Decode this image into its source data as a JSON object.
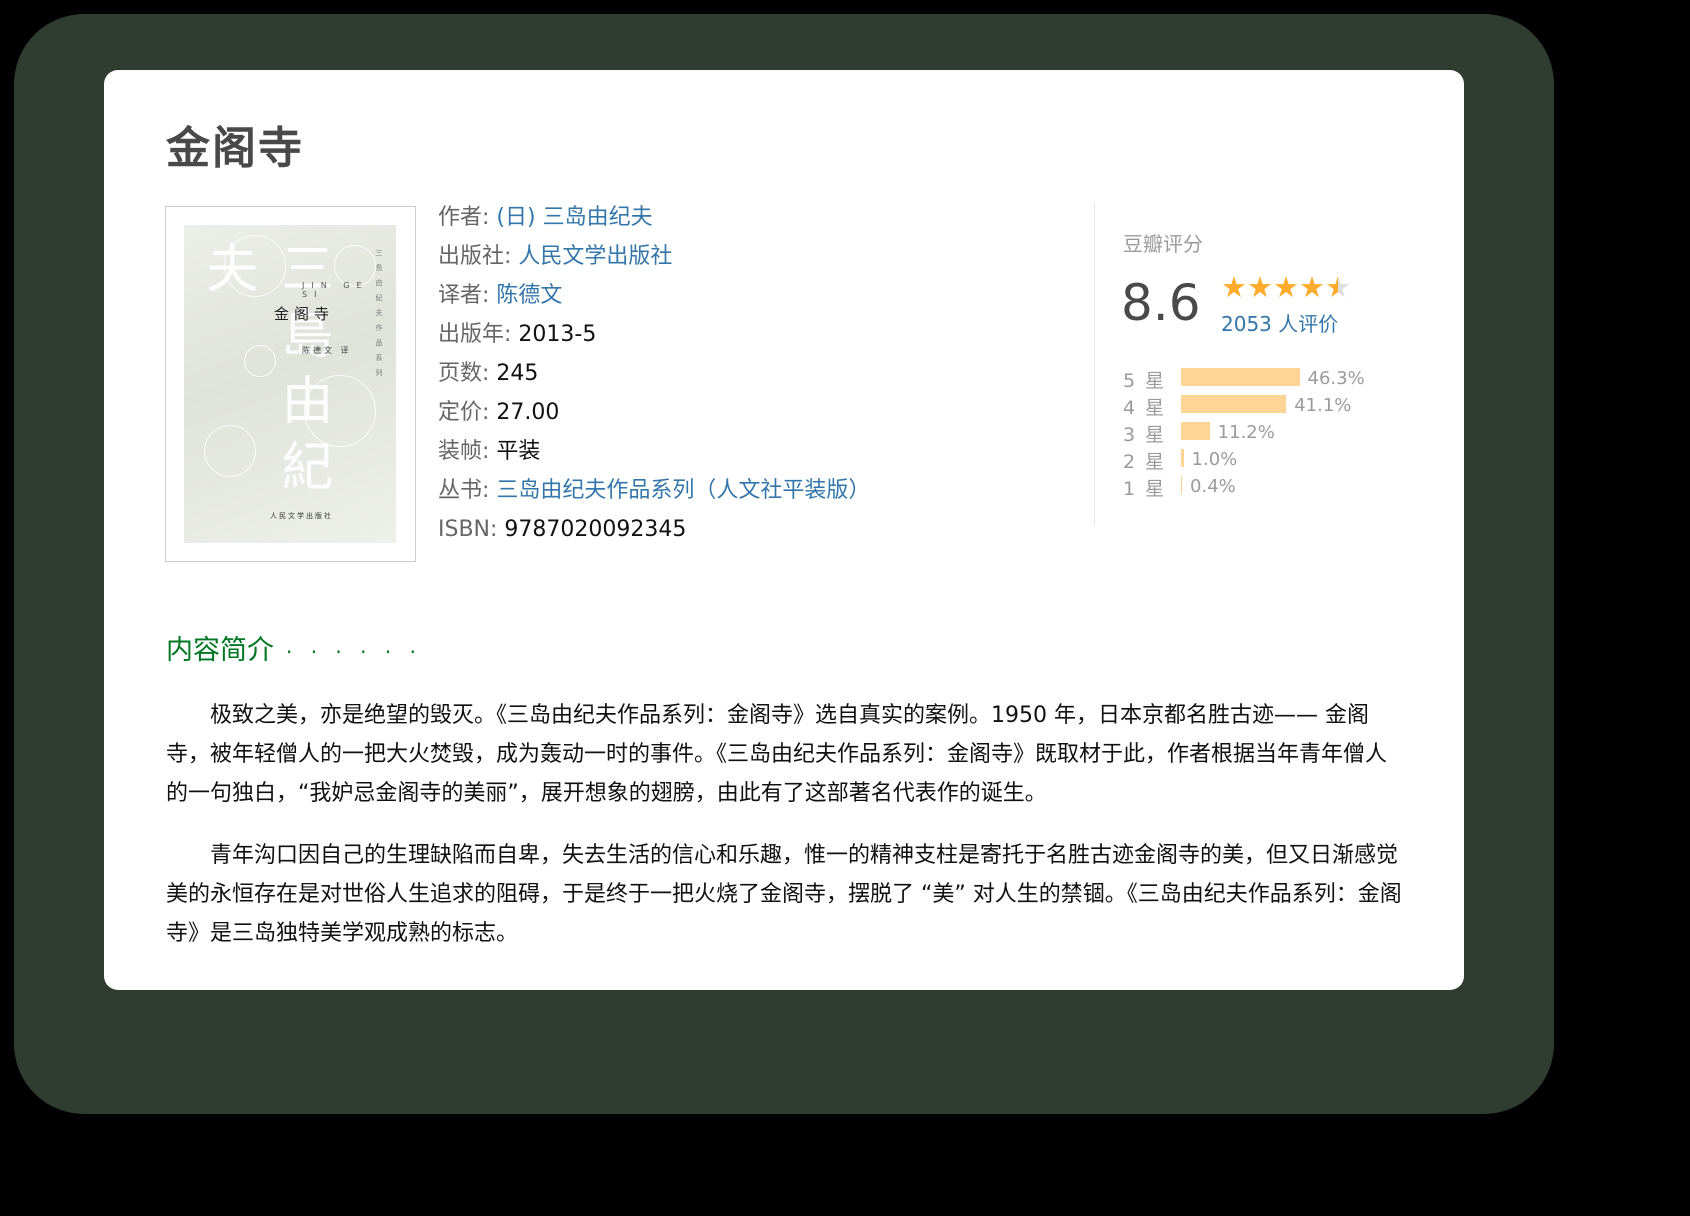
{
  "book": {
    "title": "金阁寺",
    "cover": {
      "romanized": "JIN GE SI",
      "title": "金阁寺",
      "translator_line": "陈德文 译",
      "publisher": "人民文学出版社",
      "brush_author": "三島由紀夫",
      "series_vertical": "三島由紀夫作品系列"
    },
    "info": {
      "author_label": "作者:",
      "author_value": "(日) 三岛由纪夫",
      "publisher_label": "出版社:",
      "publisher_value": "人民文学出版社",
      "translator_label": "译者:",
      "translator_value": "陈德文",
      "pubyear_label": "出版年:",
      "pubyear_value": "2013-5",
      "pages_label": "页数:",
      "pages_value": "245",
      "price_label": "定价:",
      "price_value": "27.00",
      "binding_label": "装帧:",
      "binding_value": "平装",
      "series_label": "丛书:",
      "series_value": "三岛由纪夫作品系列（人文社平装版）",
      "isbn_label": "ISBN:",
      "isbn_value": "9787020092345"
    }
  },
  "rating": {
    "title": "豆瓣评分",
    "score": "8.6",
    "stars_value": 4.5,
    "count_text": "2053 人评价",
    "colors": {
      "star": "#ffac2d",
      "star_empty": "#dddddd",
      "bar": "#ffd596"
    },
    "distribution": [
      {
        "label": "5 星",
        "percent": 46.3,
        "text": "46.3%"
      },
      {
        "label": "4 星",
        "percent": 41.1,
        "text": "41.1%"
      },
      {
        "label": "3 星",
        "percent": 11.2,
        "text": "11.2%"
      },
      {
        "label": "2 星",
        "percent": 1.0,
        "text": "1.0%"
      },
      {
        "label": "1 星",
        "percent": 0.4,
        "text": "0.4%"
      }
    ]
  },
  "intro": {
    "heading": "内容简介",
    "dots": "· · · · · ·",
    "paragraphs": [
      "极致之美，亦是绝望的毁灭。《三岛由纪夫作品系列：金阁寺》选自真实的案例。1950 年，日本京都名胜古迹—— 金阁寺，被年轻僧人的一把大火焚毁，成为轰动一时的事件。《三岛由纪夫作品系列：金阁寺》既取材于此，作者根据当年青年僧人的一句独白，“我妒忌金阁寺的美丽”，展开想象的翅膀，由此有了这部著名代表作的诞生。",
      "青年沟口因自己的生理缺陷而自卑，失去生活的信心和乐趣，惟一的精神支柱是寄托于名胜古迹金阁寺的美，但又日渐感觉美的永恒存在是对世俗人生追求的阻碍，于是终于一把火烧了金阁寺，摆脱了 “美” 对人生的禁锢。《三岛由纪夫作品系列：金阁寺》是三岛独特美学观成熟的标志。"
    ]
  }
}
